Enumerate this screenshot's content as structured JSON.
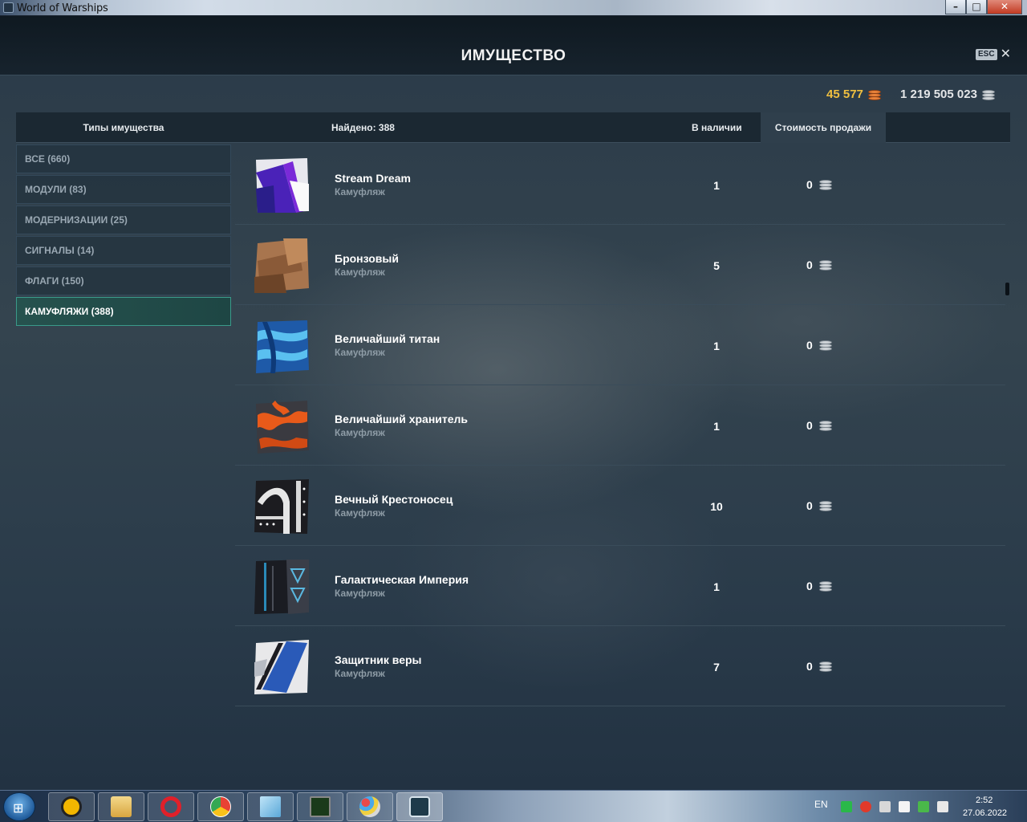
{
  "window": {
    "title": "World of Warships",
    "minimize_label": "–",
    "maximize_label": "□",
    "close_label": "✕"
  },
  "header": {
    "title": "ИМУЩЕСТВО",
    "esc_label": "ESC",
    "close_label": "✕"
  },
  "currency": {
    "doubloons": "45 577",
    "credits": "1 219 505 023"
  },
  "table": {
    "col_types": "Типы имущества",
    "col_found": "Найдено: 388",
    "col_stock": "В наличии",
    "col_price": "Стоимость продажи"
  },
  "sidebar": {
    "items": [
      {
        "label": "ВСЕ (660)"
      },
      {
        "label": "МОДУЛИ (83)"
      },
      {
        "label": "МОДЕРНИЗАЦИИ (25)"
      },
      {
        "label": "СИГНАЛЫ (14)"
      },
      {
        "label": "ФЛАГИ (150)"
      },
      {
        "label": "КАМУФЛЯЖИ (388)"
      }
    ],
    "active_index": 5
  },
  "items": [
    {
      "name": "Stream Dream",
      "type": "Камуфляж",
      "qty": "1",
      "price": "0",
      "icon": "stream-dream-camo-icon"
    },
    {
      "name": "Бронзовый",
      "type": "Камуфляж",
      "qty": "5",
      "price": "0",
      "icon": "bronze-camo-icon"
    },
    {
      "name": "Величайший титан",
      "type": "Камуфляж",
      "qty": "1",
      "price": "0",
      "icon": "greatest-titan-camo-icon"
    },
    {
      "name": "Величайший хранитель",
      "type": "Камуфляж",
      "qty": "1",
      "price": "0",
      "icon": "greatest-keeper-camo-icon"
    },
    {
      "name": "Вечный Крестоносец",
      "type": "Камуфляж",
      "qty": "10",
      "price": "0",
      "icon": "eternal-crusader-camo-icon"
    },
    {
      "name": "Галактическая Империя",
      "type": "Камуфляж",
      "qty": "1",
      "price": "0",
      "icon": "galactic-empire-camo-icon"
    },
    {
      "name": "Защитник веры",
      "type": "Камуфляж",
      "qty": "7",
      "price": "0",
      "icon": "defender-of-faith-camo-icon"
    }
  ],
  "colors": {
    "accent_active": "#3a9a8a",
    "doubloon": "#f0c040",
    "credit": "#e4e6e8"
  },
  "taskbar": {
    "lang": "EN",
    "time": "2:52",
    "date": "27.06.2022",
    "apps": [
      "windows-start-icon",
      "app-triangle-icon",
      "file-explorer-icon",
      "opera-icon",
      "chrome-icon",
      "notepad-icon",
      "monitor-icon",
      "paint-icon",
      "world-of-warships-icon"
    ]
  }
}
